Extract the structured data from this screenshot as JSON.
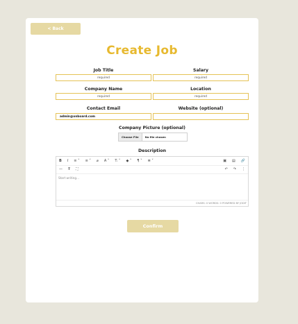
{
  "nav": {
    "back_label": "< Back"
  },
  "page": {
    "title": "Create Job"
  },
  "form": {
    "job_title": {
      "label": "Job Title",
      "placeholder": "required"
    },
    "salary": {
      "label": "Salary",
      "placeholder": "required"
    },
    "company_name": {
      "label": "Company Name",
      "placeholder": "required"
    },
    "location": {
      "label": "Location",
      "placeholder": "required"
    },
    "contact_email": {
      "label": "Contact Email",
      "value": "admin@onboard.com"
    },
    "website": {
      "label": "Website (optional)",
      "value": ""
    },
    "company_picture": {
      "label": "Company Picture (optional)",
      "button": "Choose File",
      "status": "No file chosen"
    },
    "description": {
      "label": "Description",
      "placeholder": "Start writing...",
      "status_left": "",
      "status_right": "CHARS: 0  WORDS: 0  POWERED BY JODIT"
    },
    "confirm_label": "Confirm"
  },
  "toolbar": {
    "row1": [
      "B",
      "I",
      "≡ ˅",
      "≡ ˅",
      "⌀",
      "A ˅",
      "Tᵢ ˅",
      "◆ ˅",
      "¶ ˅",
      "≣ ˅"
    ],
    "row1_right": [
      "▣",
      "▤",
      "🔗"
    ],
    "row2": [
      "—",
      "T̶",
      "⛶"
    ],
    "row2_right": [
      "↶",
      "↷",
      "⋮"
    ]
  },
  "colors": {
    "accent": "#e7b92f",
    "button": "#e6d9a3",
    "border": "#e5c255",
    "background": "#e8e6dc"
  }
}
